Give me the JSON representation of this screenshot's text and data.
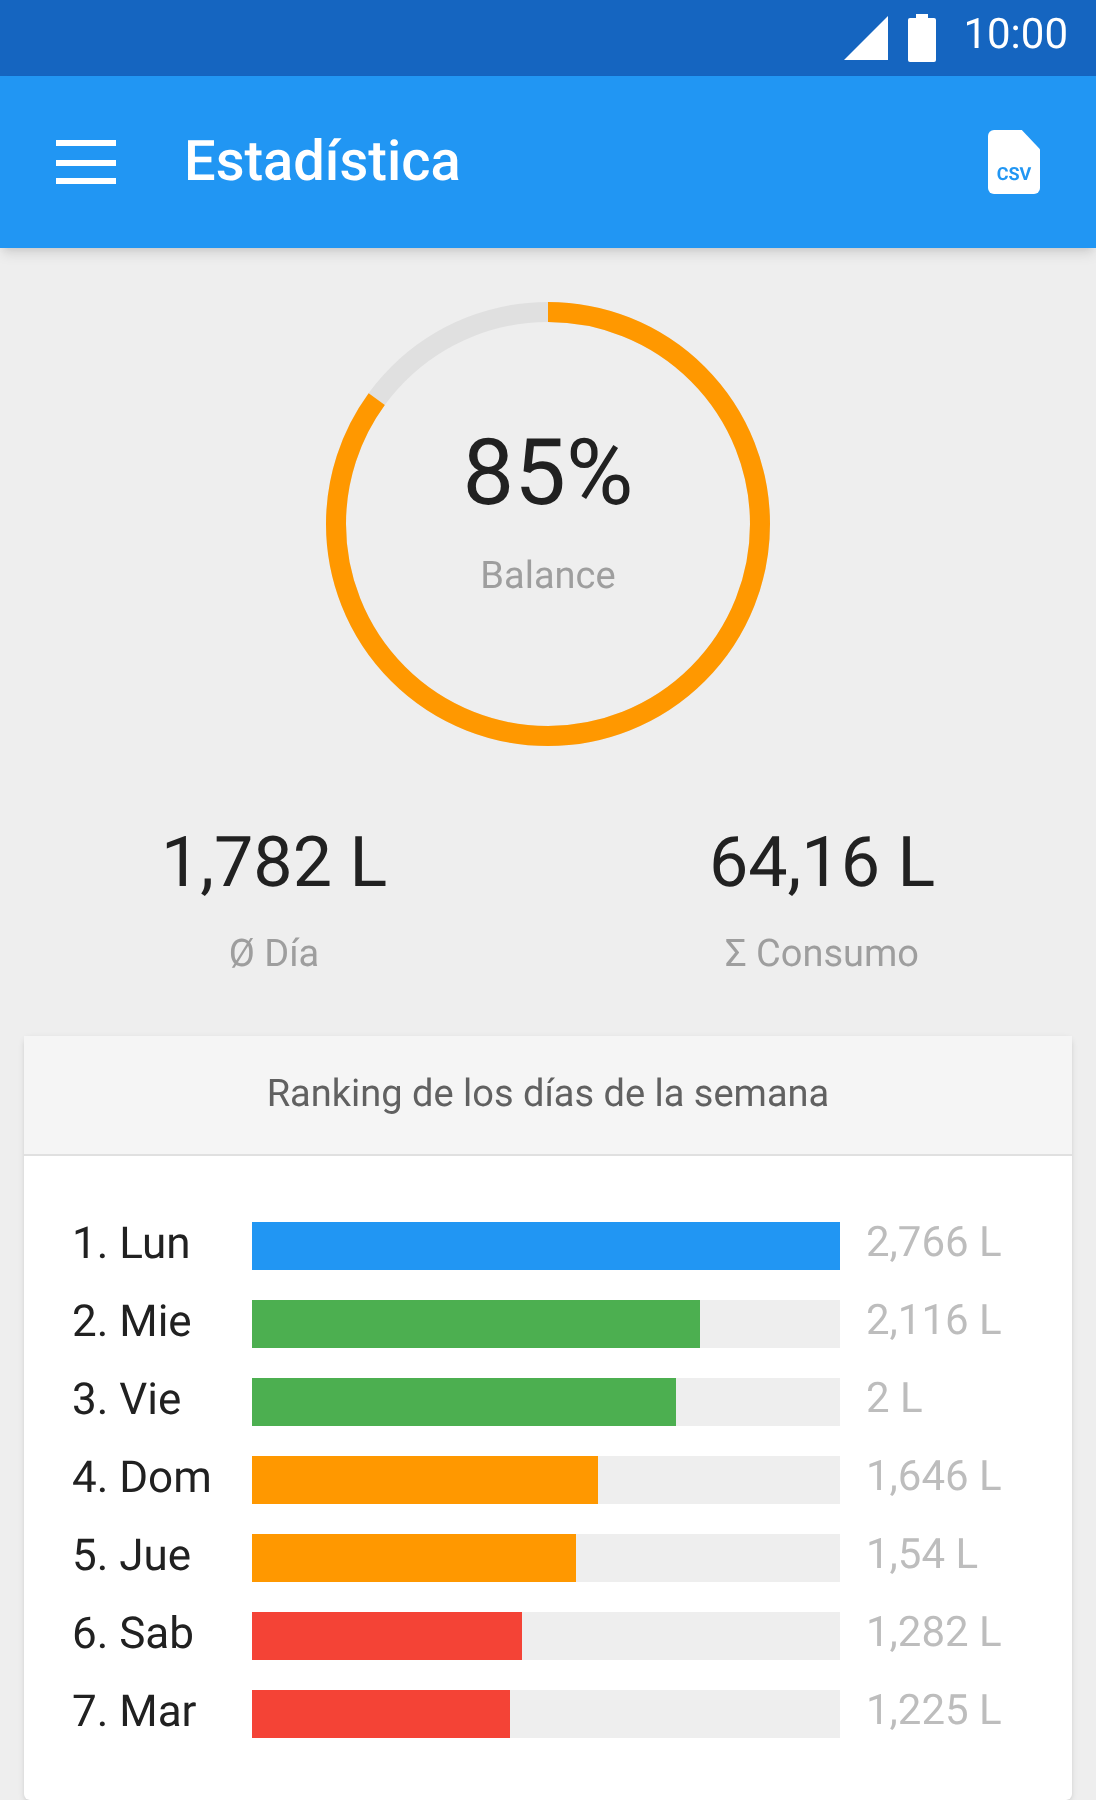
{
  "status_bar": {
    "time": "10:00"
  },
  "app_bar": {
    "title": "Estadística",
    "export_icon_label": "CSV"
  },
  "balance": {
    "value": "85%",
    "label": "Balance"
  },
  "stats": [
    {
      "value": "1,782 L",
      "label": "Ø Día"
    },
    {
      "value": "64,16 L",
      "label": "Σ Consumo"
    }
  ],
  "ranking": {
    "title": "Ranking de los días de la semana",
    "rows": [
      {
        "label": "1. Lun",
        "level": 1.0,
        "color": "#2196f3",
        "value": "2,766 L"
      },
      {
        "label": "2. Mie",
        "level": 0.762,
        "color": "#4caf50",
        "value": "2,116 L"
      },
      {
        "label": "3. Vie",
        "level": 0.72,
        "color": "#4caf50",
        "value": "2 L"
      },
      {
        "label": "4. Dom",
        "level": 0.59,
        "color": "#ff9800",
        "value": "1,646 L"
      },
      {
        "label": "5. Jue",
        "level": 0.55,
        "color": "#ff9800",
        "value": "1,54 L"
      },
      {
        "label": "6. Sab",
        "level": 0.46,
        "color": "#f44336",
        "value": "1,282 L"
      },
      {
        "label": "7. Mar",
        "level": 0.44,
        "color": "#f44336",
        "value": "1,225 L"
      }
    ]
  }
}
